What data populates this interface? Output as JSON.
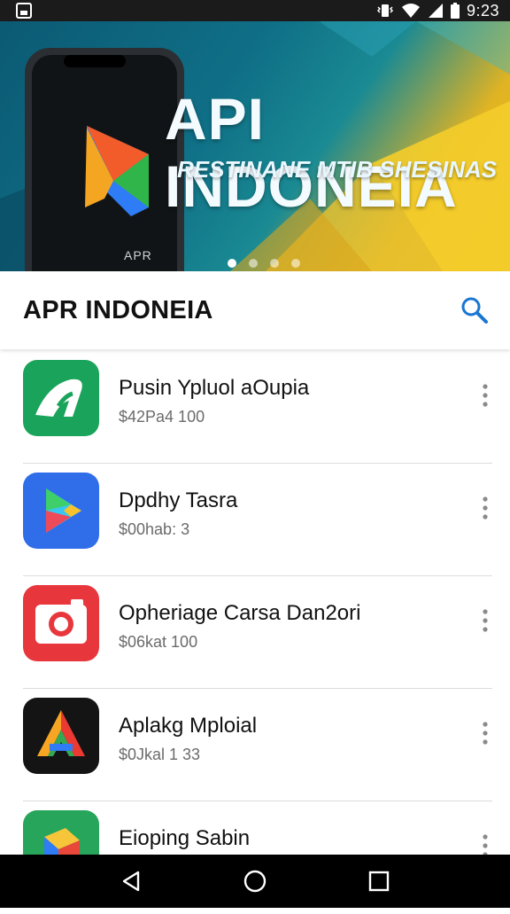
{
  "status_bar": {
    "time": "9:23"
  },
  "banner": {
    "title": "API INDONEIA",
    "subtitle": "RESTINANE MTIB SHESINAS",
    "phone_label": "APR",
    "carousel_count": 4,
    "carousel_active": 0
  },
  "appbar": {
    "title": "APR INDONEIA",
    "search_icon": "search-icon"
  },
  "apps": [
    {
      "name": "Pusin Ypluol aOupia",
      "sub": "$42Pa4 100",
      "icon": "green-a-icon"
    },
    {
      "name": "Dpdhy Tasra",
      "sub": "$00hab: 3",
      "icon": "play-store-icon"
    },
    {
      "name": "Opheriage Carsa Dan2ori",
      "sub": "$06kat 100",
      "icon": "camera-icon"
    },
    {
      "name": "Aplakg Mploial",
      "sub": "$0Jkal 1 33",
      "icon": "triangle-a-icon"
    },
    {
      "name": "Eioping Sabin",
      "sub": "",
      "icon": "cube-icon"
    }
  ],
  "colors": {
    "accent": "#1976d2",
    "banner_teal": "#0f6f86",
    "banner_yellow": "#f2c21a"
  }
}
